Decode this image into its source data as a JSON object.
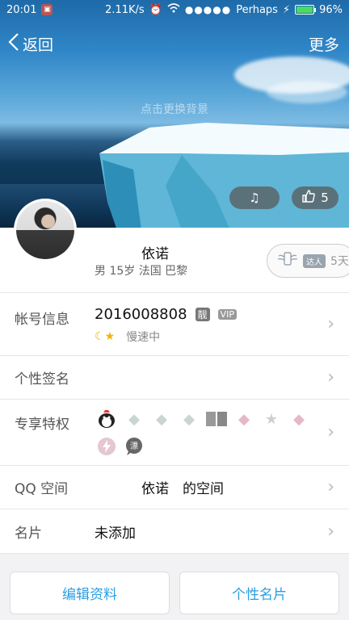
{
  "status_bar": {
    "time": "20:01",
    "network_speed": "2.11K/s",
    "carrier": "Perhaps",
    "signal_dots": "●●●●●",
    "battery_percent": "96%",
    "battery_level": 0.96
  },
  "nav": {
    "back_label": "返回",
    "more_label": "更多"
  },
  "hero": {
    "change_bg_hint": "点击更换背景",
    "like_count": "5"
  },
  "profile": {
    "nickname": "依诺",
    "details": "男 15岁 法国 巴黎",
    "talent_badge": "达人",
    "talent_days": "5天"
  },
  "rows": {
    "account": {
      "label": "帐号信息",
      "number": "2016008808",
      "pretty_tag": "靓",
      "vip_tag": "VIP",
      "speed_status": "慢速中"
    },
    "signature": {
      "label": "个性签名"
    },
    "privileges": {
      "label": "专享特权"
    },
    "qq_space": {
      "label": "QQ 空间",
      "value": "依诺　的空间"
    },
    "card": {
      "label": "名片",
      "value": "未添加"
    }
  },
  "buttons": {
    "edit_profile": "编辑资料",
    "personal_card": "个性名片"
  },
  "colors": {
    "accent": "#2a9ee0",
    "battery": "#4cd964"
  }
}
